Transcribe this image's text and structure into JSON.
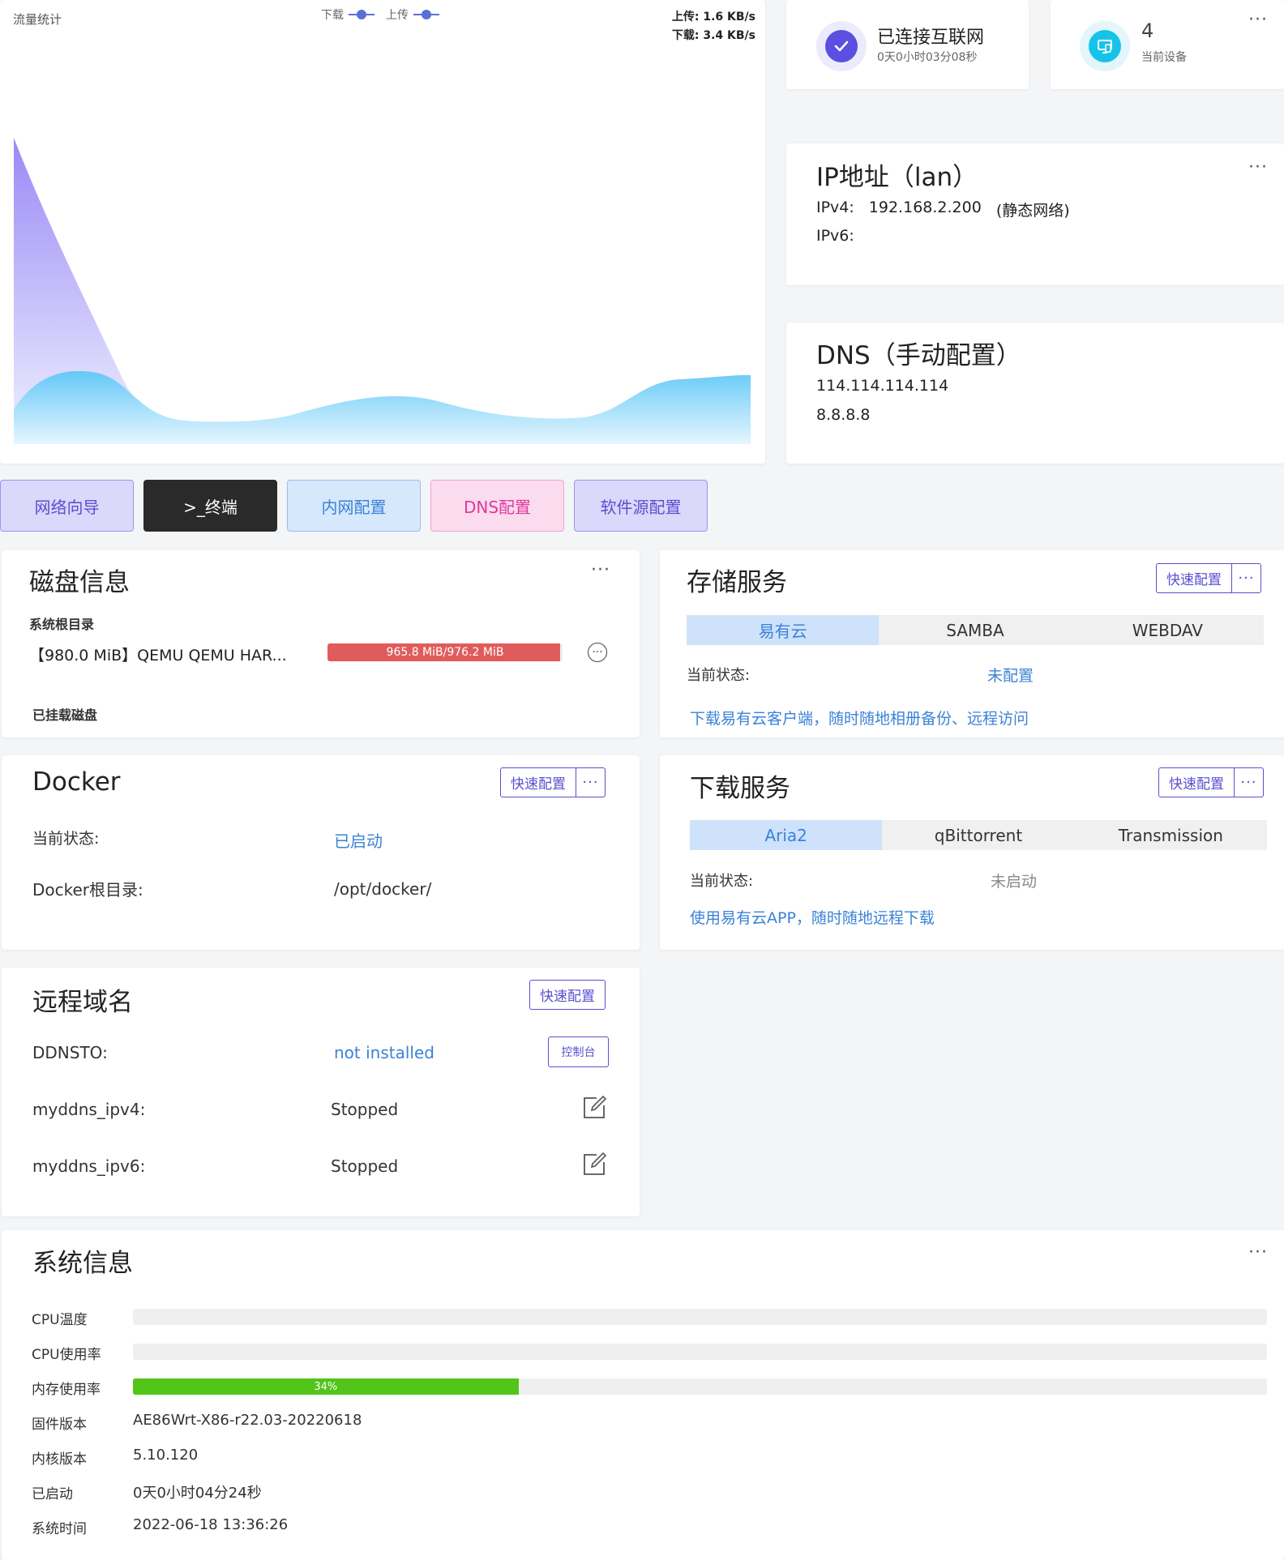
{
  "traffic": {
    "title": "流量统计",
    "legend_download": "下载",
    "legend_upload": "上传",
    "upload_rate": "上传: 1.6 KB/s",
    "download_rate": "下载: 3.4 KB/s"
  },
  "status": {
    "connected_label": "已连接互联网",
    "uptime": "0天0小时03分08秒",
    "device_count": "4",
    "device_label": "当前设备"
  },
  "ip": {
    "title": "IP地址（lan）",
    "ipv4_label": "IPv4:",
    "ipv4_value": "192.168.2.200",
    "ipv4_note": "(静态网络)",
    "ipv6_label": "IPv6:"
  },
  "dns": {
    "title": "DNS（手动配置）",
    "servers": [
      "114.114.114.114",
      "8.8.8.8"
    ]
  },
  "actions": {
    "wizard": "网络向导",
    "terminal": ">_终端",
    "lan": "内网配置",
    "dns": "DNS配置",
    "mirror": "软件源配置"
  },
  "disk": {
    "title": "磁盘信息",
    "root_label": "系统根目录",
    "root_name": "【980.0 MiB】QEMU QEMU HAR...",
    "root_usage": "965.8 MiB/976.2 MiB",
    "root_fraction": 0.989,
    "mounted_label": "已挂载磁盘"
  },
  "storage": {
    "title": "存储服务",
    "quick": "快速配置",
    "tabs": [
      "易有云",
      "SAMBA",
      "WEBDAV"
    ],
    "status_label": "当前状态:",
    "status_value": "未配置",
    "link": "下载易有云客户端，随时随地相册备份、远程访问"
  },
  "docker": {
    "title": "Docker",
    "quick": "快速配置",
    "status_label": "当前状态:",
    "status_value": "已启动",
    "root_label": "Docker根目录:",
    "root_value": "/opt/docker/"
  },
  "download": {
    "title": "下载服务",
    "quick": "快速配置",
    "tabs": [
      "Aria2",
      "qBittorrent",
      "Transmission"
    ],
    "status_label": "当前状态:",
    "status_value": "未启动",
    "link": "使用易有云APP，随时随地远程下载"
  },
  "remote": {
    "title": "远程域名",
    "quick": "快速配置",
    "ddnsto_label": "DDNSTO:",
    "ddnsto_value": "not installed",
    "console": "控制台",
    "ipv4_label": "myddns_ipv4:",
    "ipv4_value": "Stopped",
    "ipv6_label": "myddns_ipv6:",
    "ipv6_value": "Stopped"
  },
  "system": {
    "title": "系统信息",
    "cpu_temp_label": "CPU温度",
    "cpu_usage_label": "CPU使用率",
    "mem_label": "内存使用率",
    "mem_percent_text": "34%",
    "mem_fraction": 0.34,
    "fw_label": "固件版本",
    "fw_value": "AE86Wrt-X86-r22.03-20220618",
    "kernel_label": "内核版本",
    "kernel_value": "5.10.120",
    "uptime_label": "已启动",
    "uptime_value": "0天0小时04分24秒",
    "time_label": "系统时间",
    "time_value": "2022-06-18 13:36:26"
  },
  "colors": {
    "accent": "#5a4fcf",
    "link": "#3b82d6",
    "disk_bar": "#e05c5c",
    "mem_bar": "#52c41a"
  }
}
